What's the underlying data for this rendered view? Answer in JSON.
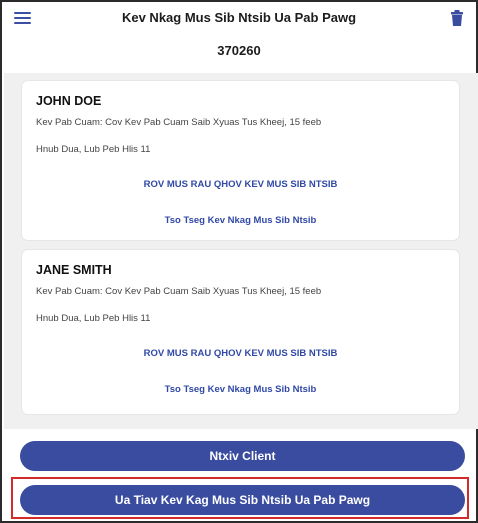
{
  "header": {
    "title": "Kev Nkag Mus Sib Ntsib Ua Pab Pawg",
    "code": "370260"
  },
  "icons": {
    "menu": "hamburger-menu-icon",
    "trash": "trash-icon"
  },
  "clients": [
    {
      "name": "JOHN DOE",
      "service_line": "Kev Pab Cuam: Cov Kev Pab Cuam Saib Xyuas Tus Kheej, 15 feeb",
      "schedule_line": "Hnub Dua, Lub Peb Hlis 11",
      "remove_link": "ROV MUS RAU QHOV KEV MUS SIB NTSIB",
      "create_link": "Tso Tseg Kev Nkag Mus Sib Ntsib"
    },
    {
      "name": "JANE SMITH",
      "service_line": "Kev Pab Cuam: Cov Kev Pab Cuam Saib Xyuas Tus Kheej, 15 feeb",
      "schedule_line": "Hnub Dua, Lub Peb Hlis 11",
      "remove_link": "ROV MUS RAU QHOV KEV MUS SIB NTSIB",
      "create_link": "Tso Tseg Kev Nkag Mus Sib Ntsib"
    }
  ],
  "buttons": {
    "add_client": "Ntxiv Client",
    "start_group_visit": "Ua Tiav Kev Kag Mus Sib Ntsib Ua Pab Pawg"
  },
  "colors": {
    "accent": "#3a4c9f",
    "link": "#3149a6",
    "highlight": "#d42a2a",
    "content_bg": "#f0f0f0"
  }
}
